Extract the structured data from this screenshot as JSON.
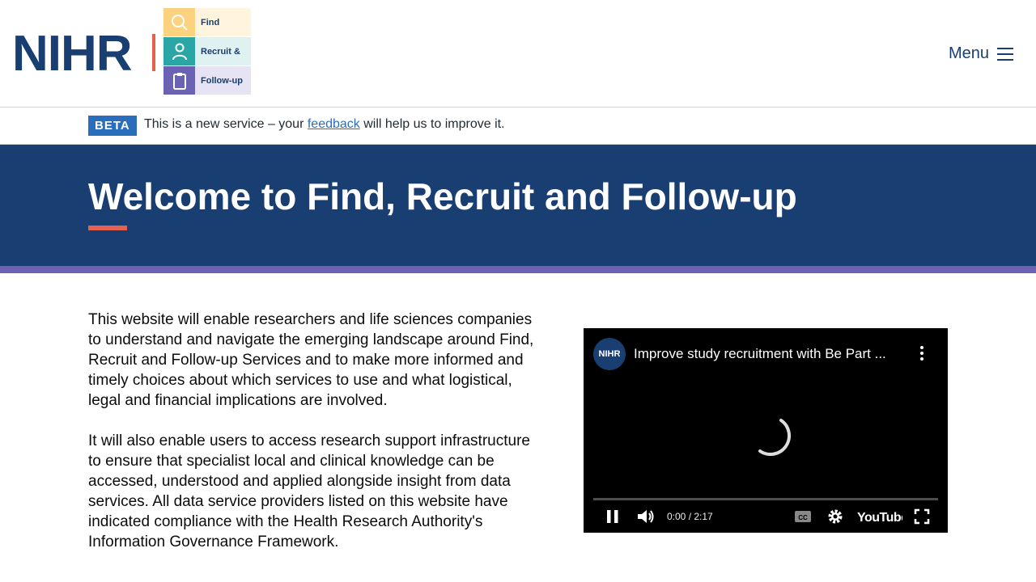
{
  "header": {
    "logo_text": "NIHR",
    "service_logo": {
      "rows": [
        {
          "label": "Find",
          "icon": "search-icon",
          "icon_bg": "#fbd27f",
          "text_bg": "#fff4de"
        },
        {
          "label": "Recruit &",
          "icon": "person-icon",
          "icon_bg": "#2aa6a6",
          "text_bg": "#dff1f0"
        },
        {
          "label": "Follow-up",
          "icon": "clipboard-icon",
          "icon_bg": "#6b62b4",
          "text_bg": "#e6e3f4"
        }
      ]
    },
    "menu_label": "Menu"
  },
  "beta_banner": {
    "tag": "BETA",
    "text_before": "This is a new service – your ",
    "link_text": "feedback",
    "text_after": " will help us to improve it."
  },
  "hero": {
    "title": "Welcome to Find, Recruit and Follow-up"
  },
  "content": {
    "paragraphs": [
      "This website will enable researchers and life sciences companies to understand and navigate the emerging landscape around Find, Recruit and Follow-up Services and to make more informed and timely choices about which services to use and what logistical, legal and financial implications are involved.",
      "It will also enable users to access research support infrastructure to ensure that specialist local and clinical knowledge can be accessed, understood and applied alongside insight from data services. All data service providers listed on this website have indicated compliance with the Health Research Authority's Information Governance Framework."
    ]
  },
  "video": {
    "channel_avatar": "NIHR",
    "title": "Improve study recruitment with Be Part ...",
    "time": "0:00 / 2:17",
    "brand": "YouTube"
  },
  "colors": {
    "navy": "#193e72",
    "accent_red": "#e5604e",
    "purple": "#6b62b4",
    "link_blue": "#2a6ebb"
  }
}
